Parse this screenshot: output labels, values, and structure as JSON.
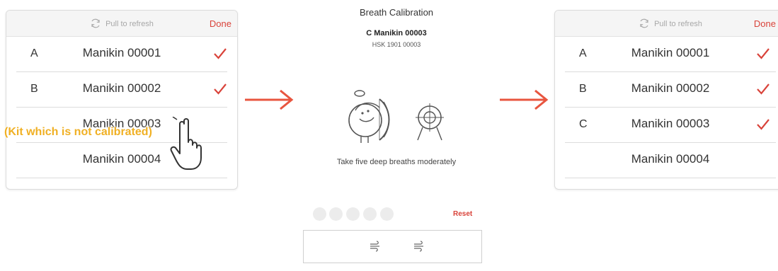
{
  "left_panel": {
    "refresh_label": "Pull to refresh",
    "done_label": "Done",
    "rows": [
      {
        "letter": "A",
        "name": "Manikin 00001",
        "checked": true
      },
      {
        "letter": "B",
        "name": "Manikin 00002",
        "checked": true
      },
      {
        "letter": "",
        "name": "Manikin 00003",
        "checked": false
      },
      {
        "letter": "",
        "name": "Manikin 00004",
        "checked": false
      }
    ]
  },
  "annotation": {
    "text": "(Kit which is not calibrated)",
    "color": "#f0b024"
  },
  "calibration": {
    "title": "Breath Calibration",
    "kit_name": "C Manikin 00003",
    "serial": "HSK 1901 00003",
    "instruction": "Take five deep breaths moderately",
    "breath_dots_total": 5,
    "breath_dots_done": 0,
    "reset_label": "Reset",
    "breath_icons": [
      "wind-icon",
      "wind-icon"
    ]
  },
  "right_panel": {
    "refresh_label": "Pull to refresh",
    "done_label": "Done",
    "rows": [
      {
        "letter": "A",
        "name": "Manikin 00001",
        "checked": true
      },
      {
        "letter": "B",
        "name": "Manikin 00002",
        "checked": true
      },
      {
        "letter": "C",
        "name": "Manikin 00003",
        "checked": true
      },
      {
        "letter": "",
        "name": "Manikin 00004",
        "checked": false
      }
    ]
  },
  "colors": {
    "accent": "#d9433a",
    "arrow": "#e8553f",
    "annotation": "#f0b024"
  }
}
